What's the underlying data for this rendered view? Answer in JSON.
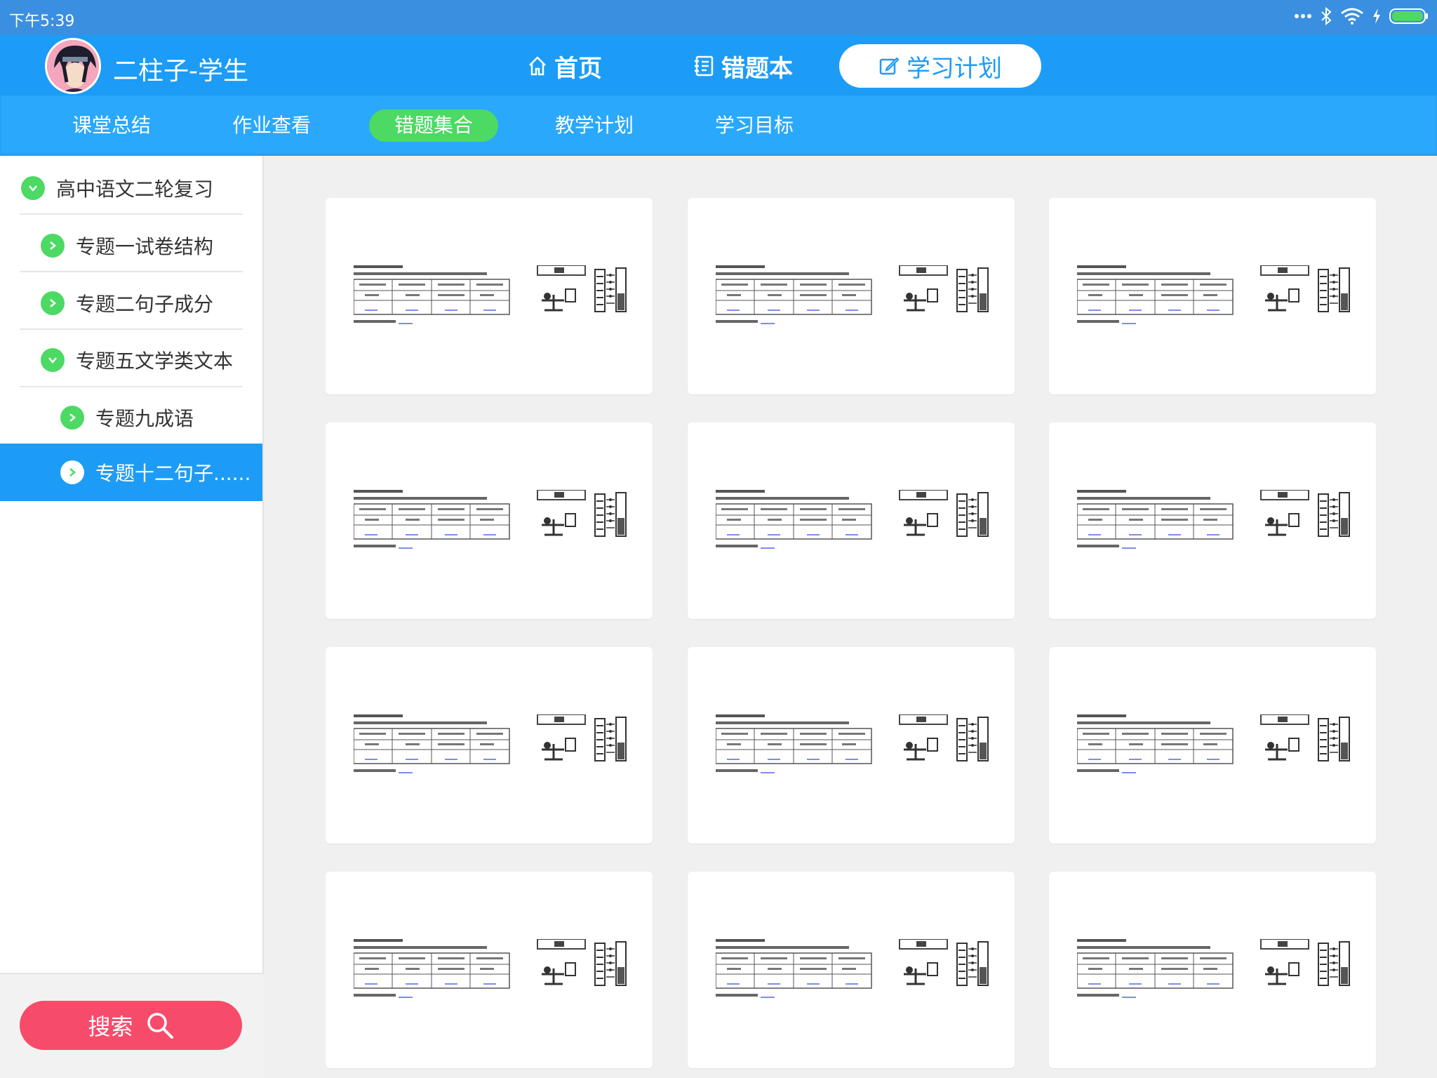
{
  "status_bar": {
    "time": "下午5:39"
  },
  "header": {
    "user_name": "二柱子-学生",
    "nav": [
      {
        "label": "首页",
        "icon": "home-icon"
      },
      {
        "label": "错题本",
        "icon": "notebook-icon"
      },
      {
        "label": "学习计划",
        "icon": "edit-icon",
        "active": true
      }
    ]
  },
  "subtabs": [
    {
      "label": "课堂总结"
    },
    {
      "label": "作业查看"
    },
    {
      "label": "错题集合",
      "active": true
    },
    {
      "label": "教学计划"
    },
    {
      "label": "学习目标"
    }
  ],
  "sidebar": {
    "items": [
      {
        "label": "高中语文二轮复习",
        "icon": "chevron-down-icon"
      },
      {
        "label": "专题一试卷结构",
        "icon": "chevron-right-icon"
      },
      {
        "label": "专题二句子成分",
        "icon": "chevron-right-icon"
      },
      {
        "label": "专题五文学类文本",
        "icon": "chevron-down-icon"
      },
      {
        "label": "专题九成语",
        "icon": "chevron-right-icon"
      },
      {
        "label": "专题十二句子......",
        "icon": "chevron-right-icon",
        "selected": true
      }
    ],
    "search_label": "搜索"
  },
  "colors": {
    "status_bar": "#3b8fe0",
    "header": "#1c9cf6",
    "subtabs": "#2aa8fb",
    "active_tab": "#4cd964",
    "search_button": "#f74b6a"
  },
  "card_count": 12
}
